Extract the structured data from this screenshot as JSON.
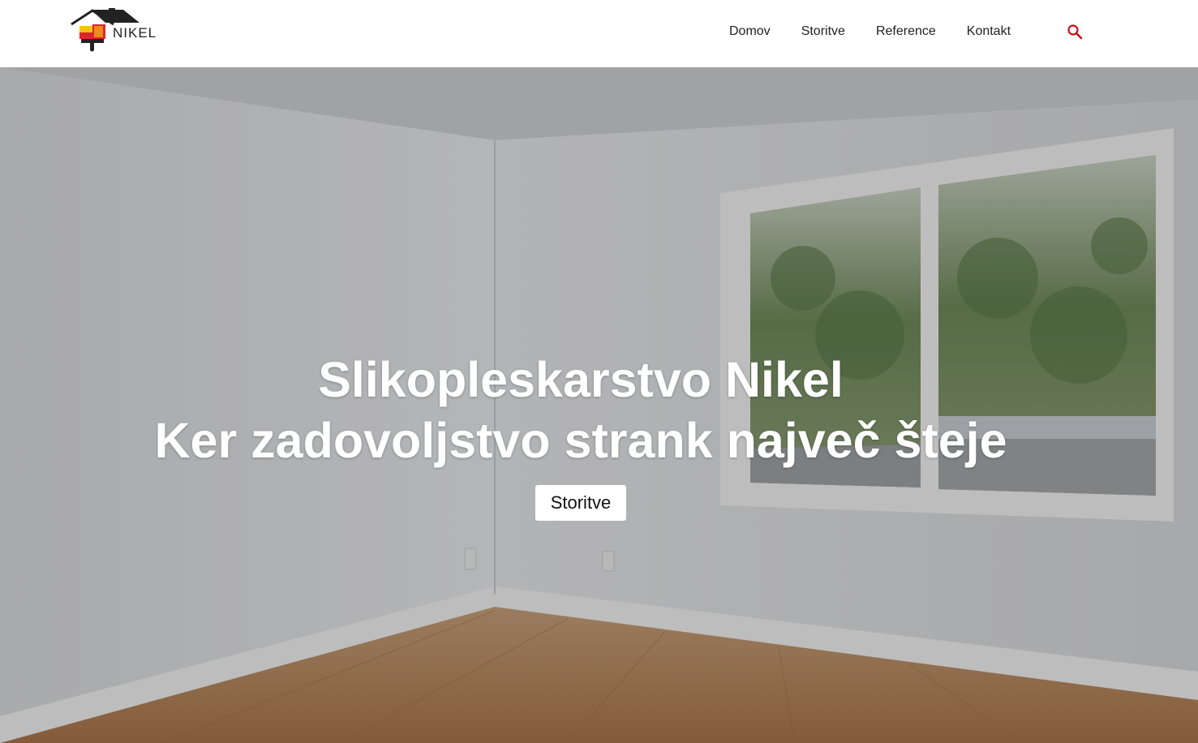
{
  "brand": {
    "logo_text": "NIKEL",
    "colors": {
      "red": "#e0232b",
      "yellow": "#f4c400",
      "orange": "#ef8a1c",
      "dark": "#222222"
    }
  },
  "nav": {
    "items": [
      {
        "label": "Domov"
      },
      {
        "label": "Storitve"
      },
      {
        "label": "Reference"
      },
      {
        "label": "Kontakt"
      }
    ],
    "search_icon": "search-icon",
    "accent_color": "#c4121a"
  },
  "hero": {
    "title_line1": "Slikopleskarstvo Nikel",
    "title_line2": "Ker zadovoljstvo strank največ šteje",
    "button_label": "Storitve"
  }
}
